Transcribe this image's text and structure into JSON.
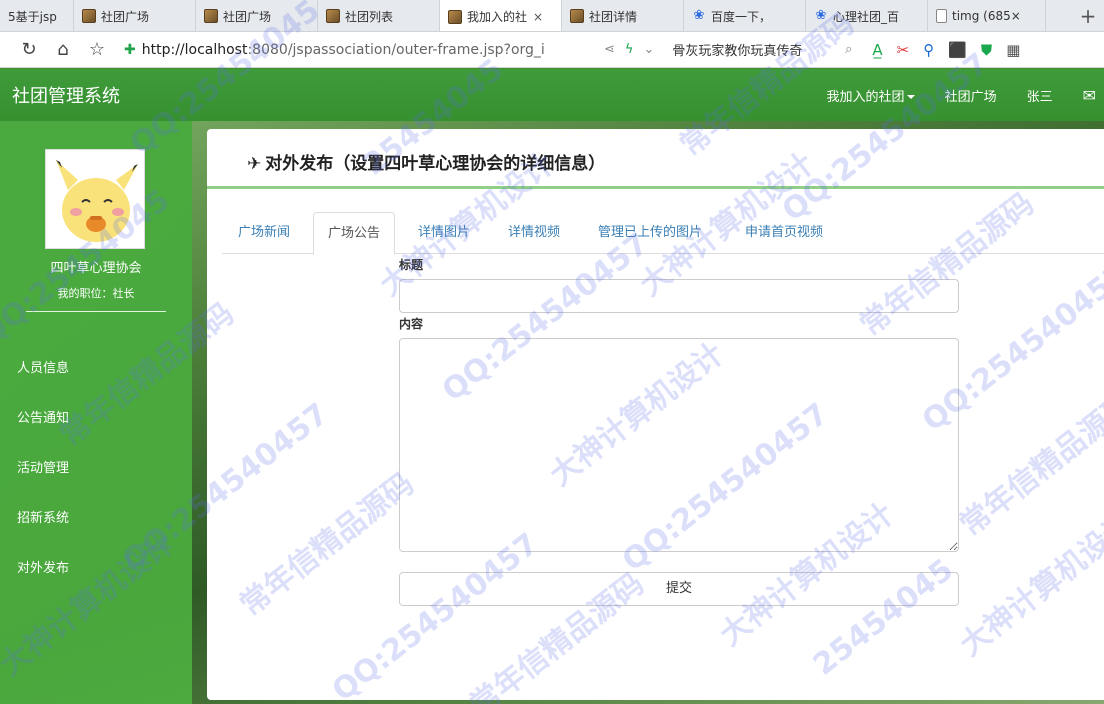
{
  "browser": {
    "tabs": [
      {
        "label": "5基于jsp",
        "favicon": "none"
      },
      {
        "label": "社团广场",
        "favicon": "image"
      },
      {
        "label": "社团广场",
        "favicon": "image"
      },
      {
        "label": "社团列表",
        "favicon": "image"
      },
      {
        "label": "我加入的社",
        "favicon": "image",
        "active": true
      },
      {
        "label": "社团详情",
        "favicon": "image"
      },
      {
        "label": "百度一下，",
        "favicon": "paw"
      },
      {
        "label": "心理社团_百",
        "favicon": "paw"
      },
      {
        "label": "timg (685×",
        "favicon": "doc"
      }
    ],
    "add_tab_label": "+",
    "close_glyph": "×",
    "url_host": "http://localhost",
    "url_rest": ":8080/jspassociation/outer-frame.jsp?org_i",
    "search_text": "骨灰玩家教你玩真传奇",
    "icons": {
      "refresh": "↻",
      "home": "⌂",
      "star": "☆",
      "shield": "✚",
      "share": "⋖",
      "bolt": "ϟ",
      "chevron": "⌄",
      "search": "⌕"
    }
  },
  "header": {
    "title": "社团管理系统",
    "nav": {
      "joined": "我加入的社团",
      "plaza": "社团广场",
      "user": "张三",
      "mail_icon": "✉"
    }
  },
  "sidebar": {
    "club_name": "四叶草心理协会",
    "role_label": "我的职位：",
    "role_value": "社长",
    "items": [
      {
        "label": "人员信息"
      },
      {
        "label": "公告通知"
      },
      {
        "label": "活动管理"
      },
      {
        "label": "招新系统"
      },
      {
        "label": "对外发布"
      }
    ]
  },
  "main": {
    "title_icon": "✈",
    "title": "对外发布（设置四叶草心理协会的详细信息）",
    "tabs": [
      {
        "label": "广场新闻"
      },
      {
        "label": "广场公告",
        "active": true
      },
      {
        "label": "详情图片"
      },
      {
        "label": "详情视频"
      },
      {
        "label": "管理已上传的图片"
      },
      {
        "label": "申请首页视频"
      }
    ],
    "form": {
      "title_label": "标题",
      "title_value": "",
      "content_label": "内容",
      "content_value": "",
      "submit_label": "提交"
    }
  },
  "watermark": {
    "qq": "QQ:25454045",
    "qq2": "QQ:254540457",
    "phrase1": "常年信精品源码",
    "phrase2": "大神计算机设计",
    "phrase3": "25454045"
  },
  "colors": {
    "header_green": "#3c9836",
    "sidebar_green": "#4fae40",
    "tab_link": "#3a7fb5",
    "accent_line": "#8fcf86"
  }
}
